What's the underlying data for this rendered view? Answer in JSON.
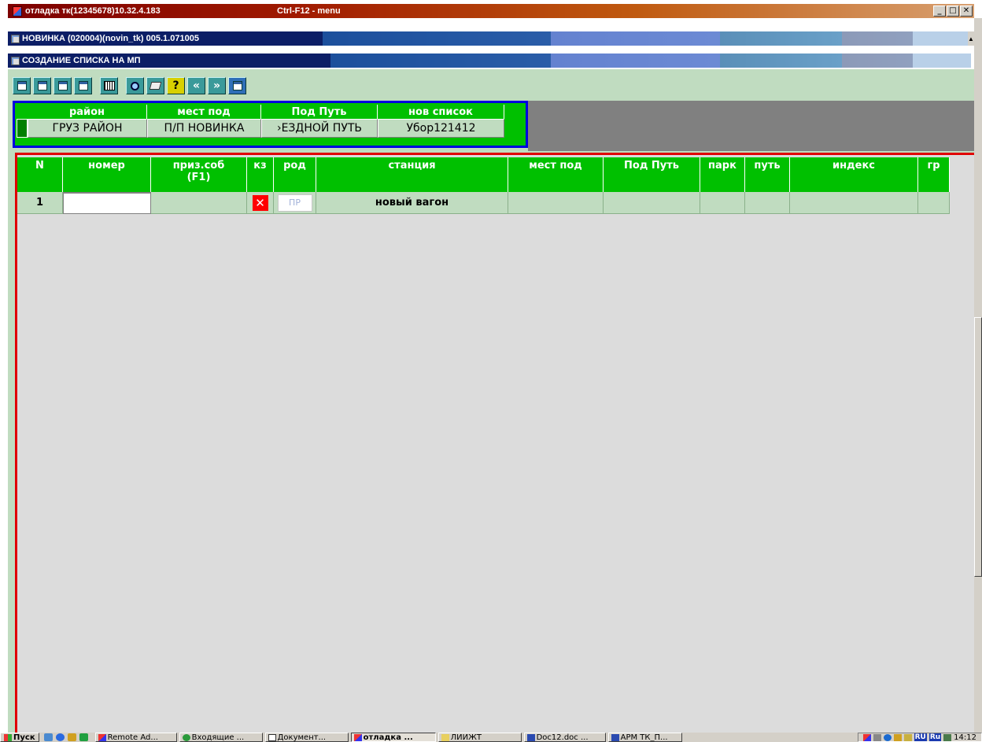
{
  "window": {
    "title": "отладка тк(12345678)10.32.4.183",
    "hint": "Ctrl-F12 - menu",
    "minimize": "_",
    "maximize": "□",
    "close": "✕"
  },
  "subwindow1": {
    "title": "НОВИНКА (020004)(novin_tk) 005.1.071005"
  },
  "subwindow2": {
    "title": "СОЗДАНИЕ СПИСКА НА МП"
  },
  "toolbar": {
    "btn_help": "?",
    "btn_prev": "«",
    "btn_next": "»"
  },
  "filter": {
    "headers": [
      "район",
      "мест под",
      "Под Путь",
      "нов список"
    ],
    "values": [
      "ГРУЗ РАЙОН",
      "П/П НОВИНКА",
      "›ЕЗДНОЙ ПУТЬ",
      "Убор121412"
    ]
  },
  "grid": {
    "headers": [
      "N",
      "номер",
      "приз.соб\n(F1)",
      "кз",
      "род",
      "станция",
      "мест под",
      "Под Путь",
      "парк",
      "путь",
      "индекс",
      "гр"
    ],
    "row": {
      "n": "1",
      "nomer": "",
      "kz_mark": "✕",
      "rod": "ПР",
      "station": "новый вагон"
    }
  },
  "taskbar": {
    "start": "Пуск",
    "tasks": [
      "Remote Ad...",
      "Входящие ...",
      "Документ...",
      "отладка ...",
      "ЛИИЖТ",
      "Doc12.doc ...",
      "АРМ ТК_П..."
    ],
    "lang1": "RU",
    "lang2": "Ru",
    "clock": "14:12"
  }
}
